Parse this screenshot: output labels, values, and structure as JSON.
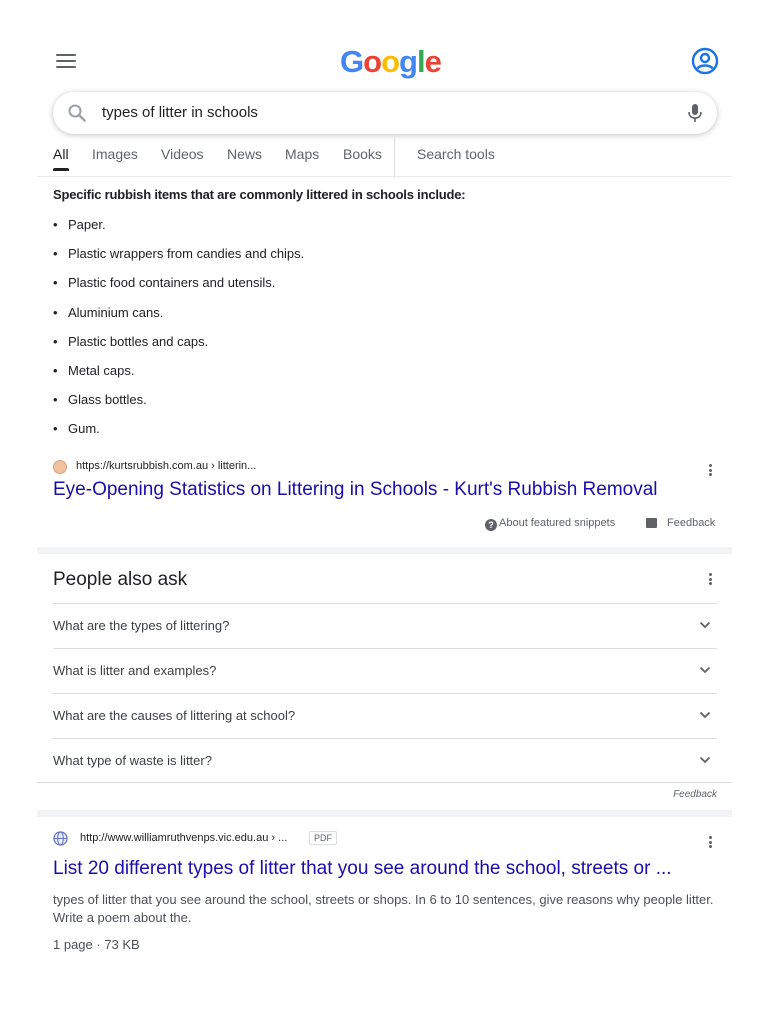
{
  "header": {
    "logo_parts": [
      "G",
      "o",
      "o",
      "g",
      "l",
      "e"
    ],
    "menu_icon": "hamburger-menu-icon",
    "account_icon": "account-circle-icon"
  },
  "search": {
    "query": "types of litter in schools",
    "search_icon": "search-icon",
    "mic_icon": "microphone-icon"
  },
  "tabs": [
    {
      "label": "All",
      "active": true
    },
    {
      "label": "Images"
    },
    {
      "label": "Videos"
    },
    {
      "label": "News"
    },
    {
      "label": "Maps"
    },
    {
      "label": "Books"
    },
    {
      "label": "Search tools"
    }
  ],
  "snippet": {
    "heading": "Specific rubbish items that are commonly littered in schools include:",
    "items": [
      "Paper.",
      "Plastic wrappers from candies and chips.",
      "Plastic food containers and utensils.",
      "Aluminium cans.",
      "Plastic bottles and caps.",
      "Metal caps.",
      "Glass bottles.",
      "Gum."
    ],
    "source_url": "https://kurtsrubbish.com.au › litterin...",
    "title": "Eye-Opening Statistics on Littering in Schools - Kurt's Rubbish Removal",
    "about_label": "About featured snippets",
    "feedback_label": "Feedback"
  },
  "paa": {
    "title": "People also ask",
    "questions": [
      "What are the types of littering?",
      "What is litter and examples?",
      "What are the causes of littering at school?",
      "What type of waste is litter?"
    ],
    "feedback_label": "Feedback"
  },
  "result2": {
    "url": "http://www.williamruthvenps.vic.edu.au › ...",
    "badge": "PDF",
    "title": "List 20 different types of litter that you see around the school, streets or ...",
    "description": "types of litter that you see around the school, streets or shops. In 6 to 10 sentences, give reasons why people litter. Write a poem about the.",
    "meta": "1 page · 73 KB"
  },
  "colors": {
    "link": "#1a0dab",
    "text": "#202124",
    "secondary": "#5f6368",
    "google_blue": "#4285f4",
    "google_red": "#ea4335",
    "google_yellow": "#fbbc05",
    "google_green": "#34a853"
  }
}
